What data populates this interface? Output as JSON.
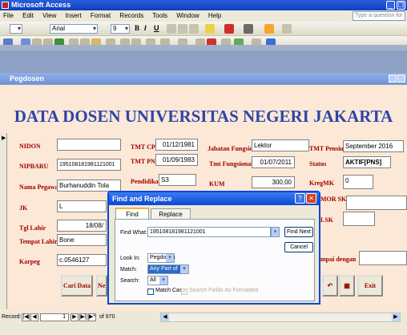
{
  "app": {
    "title": "Microsoft Access",
    "ask_placeholder": "Type a question for help"
  },
  "menu": [
    "File",
    "Edit",
    "View",
    "Insert",
    "Format",
    "Records",
    "Tools",
    "Window",
    "Help"
  ],
  "format": {
    "font": "Arial",
    "size": "9",
    "bold": "B",
    "italic": "I",
    "underline": "U"
  },
  "form": {
    "window_title": "Pegdosen",
    "heading": "DATA DOSEN UNIVERSITAS NEGERI JAKARTA"
  },
  "fields": {
    "nidn_label": "NIDON",
    "nidn": "",
    "nipbaru_label": "NIPBARU",
    "nipbaru": "195108181981121001",
    "nama_label": "Nama Pegawai",
    "nama": "Burhanuddin Tola",
    "jk_label": "JK",
    "jk": "L",
    "tgllahir_label": "Tgl Lahir",
    "tgllahir": "18/08/",
    "tempat_label": "Tempat Lahir",
    "tempat": "Bone",
    "karpeg_label": "Karpeg",
    "karpeg": "c.0546127",
    "tmtcpns_label": "TMT CPNS",
    "tmtcpns": "01/12/1981",
    "tmtpns_label": "TMT PNS",
    "tmtpns": "01/09/1983",
    "pendidikan_label": "Pendidikan",
    "pendidikan": "S3",
    "jabfung_label": "Jabatan Fungsional",
    "jabfung": "Lektor",
    "tmtfung_label": "Tmt Fungsional",
    "tmtfung": "01/07/2011",
    "kum_label": "KUM",
    "kum": "300,00",
    "tmtpensiun_label": "TMT Pensiun",
    "tmtpensiun": "September 2016",
    "status_label": "Status",
    "status": "AKTIF[PNS]",
    "kregmk_label": "KregMK",
    "kregmk": "0",
    "nomorsk_label": "MOR SK",
    "lsk_label": "LSK",
    "sampai_label": "mpai dengan"
  },
  "buttons": {
    "cari": "Cari Data",
    "next": "Nex",
    "exit": "Exit"
  },
  "dialog": {
    "title": "Find and Replace",
    "tab_find": "Find",
    "tab_replace": "Replace",
    "findwhat_label": "Find What:",
    "findwhat": "195108181981121001",
    "findnext": "Find Next",
    "cancel": "Cancel",
    "lookin_label": "Look In:",
    "lookin": "Pegdosen",
    "match_label": "Match:",
    "match": "Any Part of Field",
    "search_label": "Search:",
    "search": "All",
    "matchcase": "Match Case",
    "searchformatted": "Search Fields As Formatted"
  },
  "nav": {
    "label": "Record:",
    "current": "1",
    "total_text": "of 970"
  }
}
